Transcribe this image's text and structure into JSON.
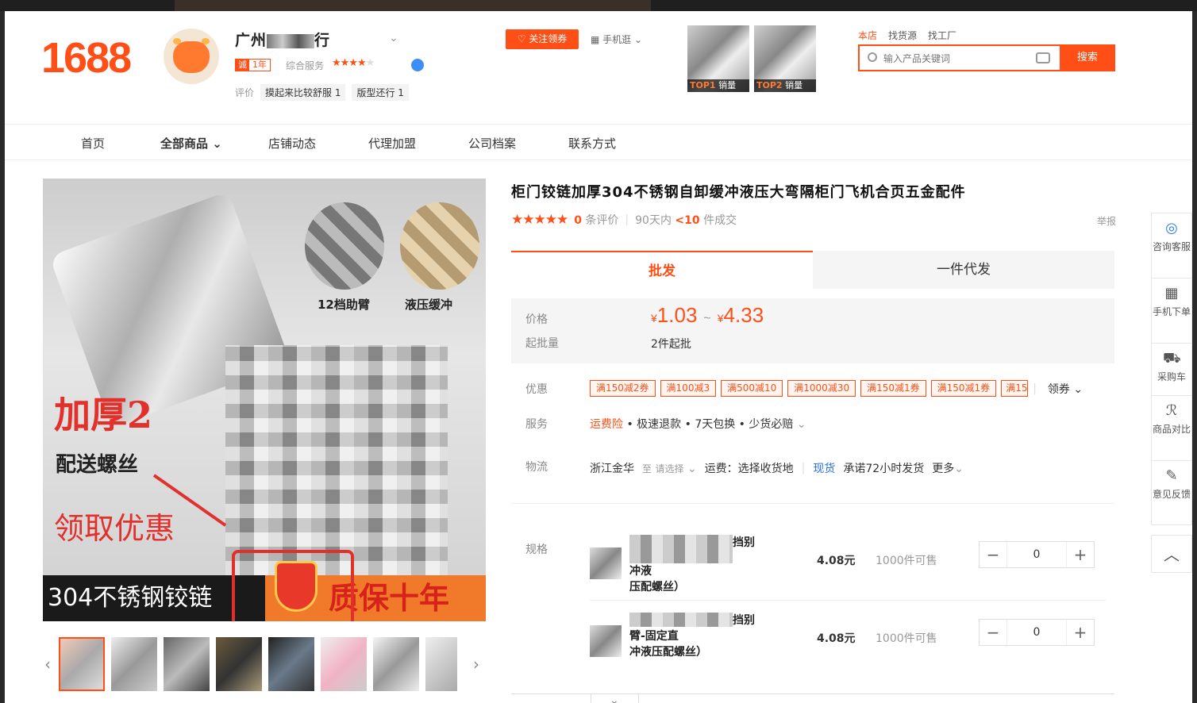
{
  "header": {
    "logo": "1688",
    "shop_name_prefix": "广州",
    "shop_name_suffix": "行",
    "year_badge_char": "诚",
    "year_badge_text": "1年",
    "service_label": "综合服务",
    "service_stars": "★★★★",
    "service_stars_off": "★",
    "review_label": "评价",
    "review_tags": [
      "摸起来比较舒服 1",
      "版型还行 1"
    ],
    "follow_label": "关注领券",
    "mobile_label": "手机逛",
    "top_products": [
      {
        "rank": "TOP1",
        "text": "销量"
      },
      {
        "rank": "TOP2",
        "text": "销量"
      }
    ],
    "search_tabs": [
      "本店",
      "找货源",
      "找工厂"
    ],
    "search_placeholder": "输入产品关键词",
    "search_button": "搜索"
  },
  "nav": {
    "items": [
      "首页",
      "全部商品",
      "店铺动态",
      "代理加盟",
      "公司档案",
      "联系方式"
    ]
  },
  "gallery": {
    "caption_1": "12档助臂",
    "caption_2": "液压缓冲",
    "thick_text": "加厚2",
    "screws_text": "配送螺丝",
    "coupon_text": "领取优惠",
    "banner_left": "304不锈钢铰链",
    "banner_right": "质保十年"
  },
  "product": {
    "title": "柜门铰链加厚304不锈钢自卸缓冲液压大弯隔柜门飞机合页五金配件",
    "rating_stars": "★★★★★",
    "review_count": "0",
    "review_suffix": "条评价",
    "sales_prefix": "90天内",
    "sales_value": "<10",
    "sales_suffix": "件成交",
    "report": "举报",
    "tab_wholesale": "批发",
    "tab_dropship": "一件代发",
    "price_label": "价格",
    "price_min": "1.03",
    "price_max": "4.33",
    "currency": "¥",
    "price_sep": "~",
    "moq_label": "起批量",
    "moq_value": "2件起批",
    "promo_label": "优惠",
    "coupons": [
      "满150减2券",
      "满100减3",
      "满500减10",
      "满1000减30",
      "满150减1券",
      "满150减1券",
      "满15"
    ],
    "coupon_get": "领券",
    "service_label": "服务",
    "services_highlight": "运费险",
    "services_rest": " • 极速退款 • 7天包换 • 少货必赔",
    "logistics_label": "物流",
    "ship_from": "浙江金华",
    "ship_to_prefix": "至",
    "ship_to": "请选择",
    "freight": "运费：选择收货地",
    "stock_tag": "现货",
    "ship_promise": "承诺72小时发货",
    "more": "更多",
    "spec_label": "规格",
    "skus": [
      {
        "name_a": "挡别",
        "name_b": "冲液",
        "name_c": "压配螺丝）",
        "price": "4.08元",
        "stock": "1000件可售",
        "qty": "0"
      },
      {
        "name_a": "挡别",
        "name_b": "臂-固定直",
        "name_c": "冲液压配螺丝）",
        "price": "4.08元",
        "stock": "1000件可售",
        "qty": "0"
      }
    ]
  },
  "dock": {
    "items": [
      {
        "icon": "service-icon",
        "label": "咨询客服"
      },
      {
        "icon": "qrcode-icon",
        "label": "手机下单"
      },
      {
        "icon": "cart-icon",
        "label": "采购车"
      },
      {
        "icon": "compare-icon",
        "label": "商品对比"
      },
      {
        "icon": "feedback-icon",
        "label": "意见反馈"
      }
    ],
    "back_to_top_icon": "chevron-up-icon"
  },
  "colors": {
    "brand": "#ff4f17",
    "link_blue": "#2b6ee8",
    "banner_red": "#e2302b"
  }
}
